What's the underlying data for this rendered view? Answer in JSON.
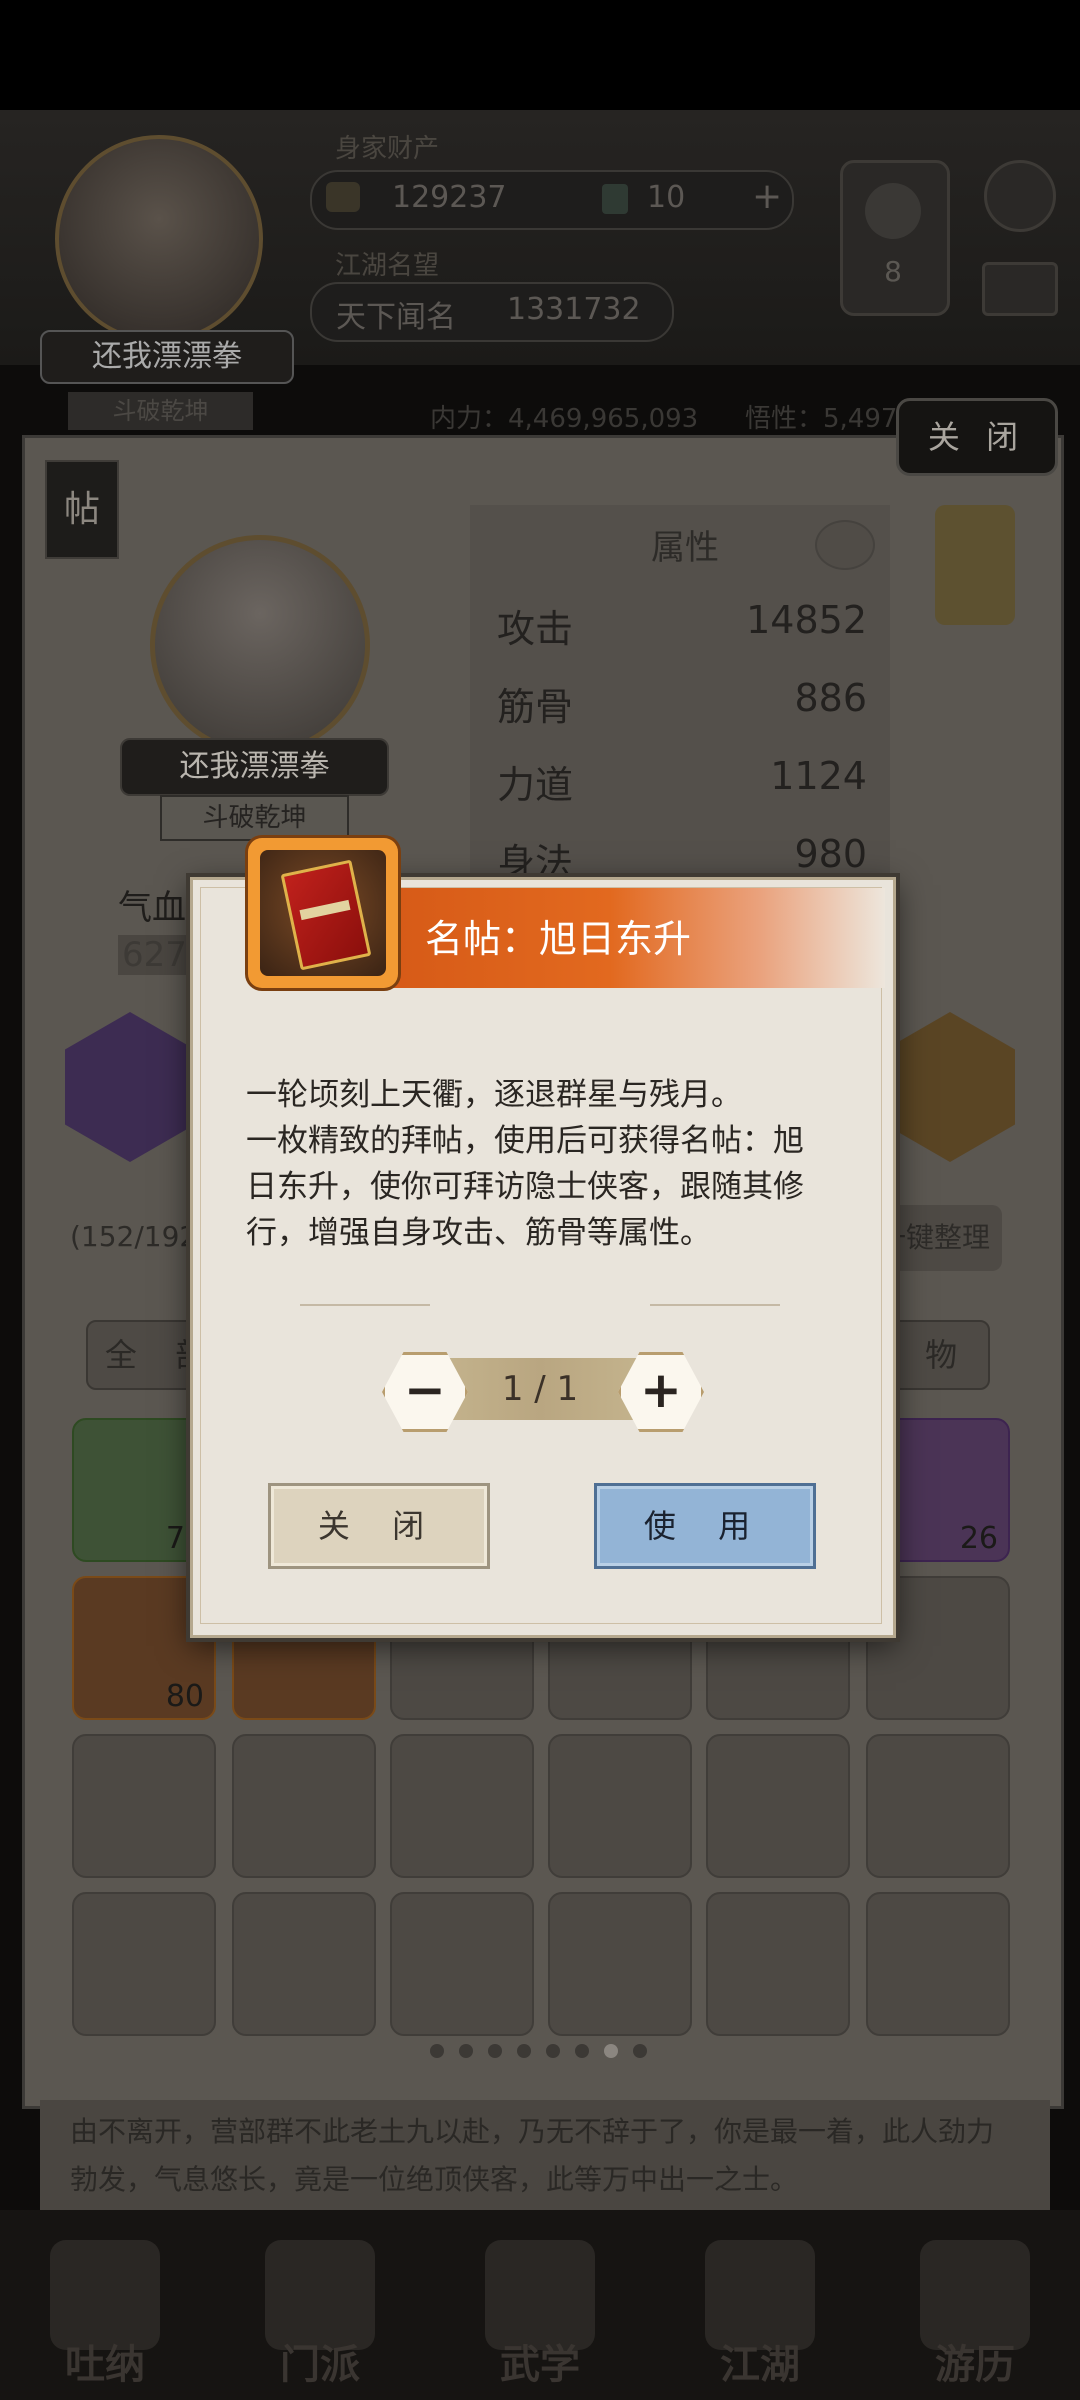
{
  "header": {
    "label_wealth": "身家财产",
    "silver": "129237",
    "jade": "10",
    "label_fame": "江湖名望",
    "fame_label": "天下闻名",
    "fame_value": "1331732",
    "player_name": "还我漂漂拳",
    "player_title": "斗破乾坤",
    "taiji_count": "8",
    "neili": "内力：4,469,965,093",
    "jingjie": "悟性：5,497"
  },
  "panel": {
    "close_label": "关 闭",
    "tie_label": "帖",
    "char_name": "还我漂漂拳",
    "char_title": "斗破乾坤",
    "attr_title": "属性",
    "attributes": [
      {
        "name": "攻击",
        "value": "14852"
      },
      {
        "name": "筋骨",
        "value": "886"
      },
      {
        "name": "力道",
        "value": "1124"
      },
      {
        "name": "身法",
        "value": "980"
      }
    ],
    "hp_label": "气血",
    "hp_value": "627",
    "bag_count": "(152/192",
    "sort_label": "一键整理",
    "tab_all": "全 部",
    "tab_misc": "杂 物",
    "items": [
      {
        "count": "75"
      },
      {
        "count": "26"
      },
      {
        "count": "80"
      }
    ],
    "bottom_text": "由不离开，营部群不此老土九以赴，乃无不辞于了，你是最一着，此人劲力勃发，气息悠长，竟是一位绝顶侠客，此等万中出一之士。"
  },
  "nav": [
    "吐纳",
    "门派",
    "武学",
    "江湖",
    "游历"
  ],
  "modal": {
    "title": "名帖：旭日东升",
    "desc_line1": "一轮顷刻上天衢，逐退群星与残月。",
    "desc_line2": "一枚精致的拜帖，使用后可获得名帖：旭日东升，使你可拜访隐士侠客，跟随其修行，增强自身攻击、筋骨等属性。",
    "quantity": "1 / 1",
    "minus": "−",
    "plus": "+",
    "close_button": "关 闭",
    "use_button": "使 用"
  },
  "colors": {
    "title_orange": "#e2691f",
    "use_button_blue": "#93b4d6",
    "modal_bg": "#e9e4db"
  }
}
